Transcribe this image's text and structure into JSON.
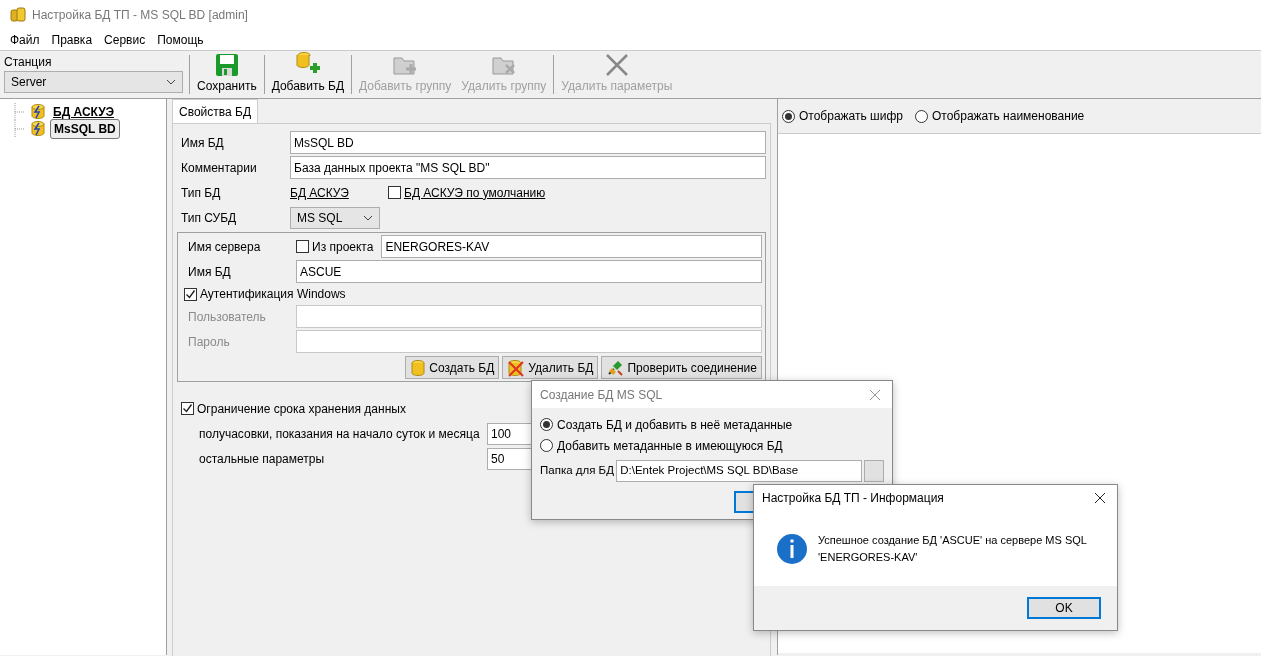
{
  "window": {
    "title": "Настройка БД ТП - MS SQL BD [admin]"
  },
  "menu": [
    "Файл",
    "Правка",
    "Сервис",
    "Помощь"
  ],
  "station": {
    "label": "Станция",
    "value": "Server"
  },
  "toolbar": [
    {
      "label": "Сохранить",
      "disabled": false
    },
    {
      "label": "Добавить БД",
      "disabled": false
    },
    {
      "label": "Добавить группу",
      "disabled": true
    },
    {
      "label": "Удалить группу",
      "disabled": true
    },
    {
      "label": "Удалить параметры",
      "disabled": true
    }
  ],
  "tree": [
    {
      "label": "БД АСКУЭ",
      "selected": false
    },
    {
      "label": "MsSQL BD",
      "selected": true
    }
  ],
  "tabs": [
    {
      "label": "Свойства БД",
      "selected": true
    }
  ],
  "properties": {
    "name_label": "Имя БД",
    "name_value": "MsSQL BD",
    "comment_label": "Комментарии",
    "comment_value": "База данных проекта \"MS SQL BD\"",
    "type_label": "Тип БД",
    "type_link": "БД АСКУЭ",
    "default_label": "БД АСКУЭ по умолчанию",
    "default_checked": false,
    "dbms_label": "Тип СУБД",
    "dbms_value": "MS SQL"
  },
  "connection": {
    "server_label": "Имя сервера",
    "from_project_label": "Из проекта",
    "from_project_checked": false,
    "server_value": "ENERGORES-KAV",
    "db_label": "Имя БД",
    "db_value": "ASCUE",
    "auth_label": "Аутентификация Windows",
    "auth_checked": true,
    "user_label": "Пользователь",
    "password_label": "Пароль",
    "credentials_disabled": true,
    "buttons": [
      "Создать БД",
      "Удалить БД",
      "Проверить соединение"
    ]
  },
  "retention": {
    "label": "Ограничение срока хранения данных",
    "checked": true,
    "rows": [
      {
        "label": "получасовки, показания на начало суток и месяца",
        "value": "100"
      },
      {
        "label": "остальные параметры",
        "value": "50"
      }
    ]
  },
  "display_options": [
    {
      "label": "Отображать шифр",
      "selected": true
    },
    {
      "label": "Отображать наименование",
      "selected": false
    }
  ],
  "create_dialog": {
    "title": "Создание БД MS SQL",
    "options": [
      {
        "label": "Создать БД и добавить в неё метаданные",
        "selected": true
      },
      {
        "label": "Добавить метаданные в имеющуюся БД",
        "selected": false
      }
    ],
    "folder_label": "Папка для БД",
    "folder_value": "D:\\Entek Project\\MS SQL BD\\Base"
  },
  "info_dialog": {
    "title": "Настройка БД ТП - Информация",
    "message": "Успешное создание БД 'ASCUE' на сервере MS SQL 'ENERGORES-KAV'",
    "button": "OK"
  }
}
